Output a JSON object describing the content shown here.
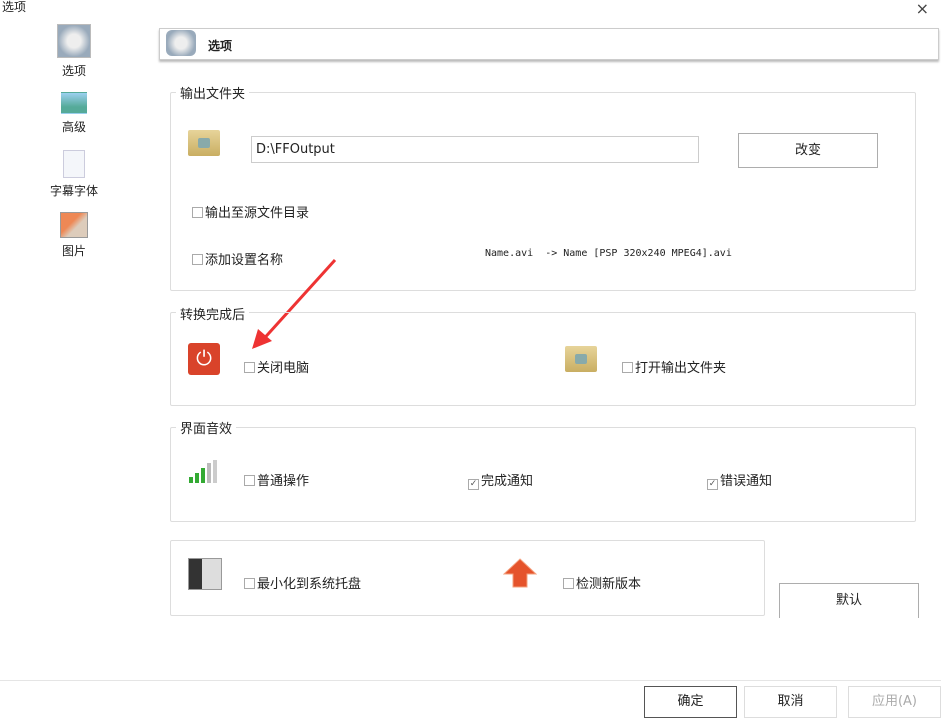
{
  "window": {
    "title": "选项",
    "close": "×"
  },
  "sidebar": {
    "items": [
      {
        "label": "选项",
        "icon": "options-icon"
      },
      {
        "label": "高级",
        "icon": "landscape-icon"
      },
      {
        "label": "字幕字体",
        "icon": "document-icon"
      },
      {
        "label": "图片",
        "icon": "picture-icon"
      }
    ]
  },
  "header": {
    "title": "选项"
  },
  "output": {
    "legend": "输出文件夹",
    "path": "D:\\FFOutput",
    "change": "改变",
    "to_source": "输出至源文件目录",
    "add_name": "添加设置名称",
    "example": "Name.avi  -> Name [PSP 320x240 MPEG4].avi"
  },
  "after": {
    "legend": "转换完成后",
    "shutdown": "关闭电脑",
    "open_folder": "打开输出文件夹"
  },
  "sound": {
    "legend": "界面音效",
    "normal": "普通操作",
    "done": "完成通知",
    "error": "错误通知",
    "done_checked": true,
    "error_checked": true
  },
  "misc": {
    "tray": "最小化到系统托盘",
    "update": "检测新版本",
    "default": "默认"
  },
  "footer": {
    "ok": "确定",
    "cancel": "取消",
    "apply": "应用(A)"
  },
  "colors": {
    "power": "#d9432a",
    "arrow": "#e5532b"
  }
}
